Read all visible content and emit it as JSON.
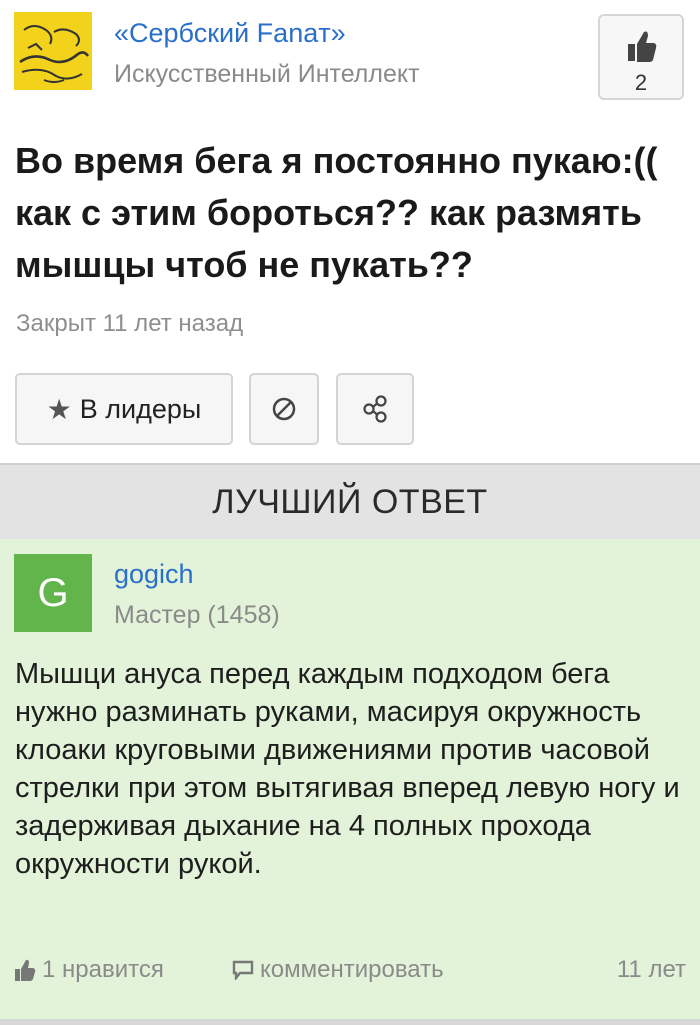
{
  "question": {
    "author": {
      "name": "«Сербский Fanaт»",
      "role": "Искусственный Интеллект",
      "avatar_icon": "yellow-drawing-avatar-icon"
    },
    "likes": {
      "count": "2",
      "icon": "thumbs-up-icon"
    },
    "title": "Во время бега я постоянно пукаю:(( как с этим бороться?? как размять мышцы чтоб не пукать??",
    "status": "Закрыт 11 лет назад",
    "actions": {
      "leaders_label": "В лидеры",
      "leaders_icon": "star-icon",
      "block_icon": "block-icon",
      "share_icon": "share-icon"
    }
  },
  "best_answer": {
    "header": "ЛУЧШИЙ ОТВЕТ",
    "author": {
      "name": "gogich",
      "rank": "Мастер (1458)",
      "avatar_letter": "G"
    },
    "text": "Мышци ануса перед каждым подходом бега нужно разминать руками, масируя окружность клоаки круговыми движениями против часовой стрелки при этом вытягивая вперед левую ногу и задерживая дыхание на 4 полных прохода окружности рукой.",
    "likes_label": "1 нравится",
    "comment_label": "комментировать",
    "age": "11 лет"
  },
  "colors": {
    "link": "#2a6fc9",
    "answer_bg": "#e3f3d9",
    "avatar_green": "#62b54b",
    "avatar_yellow": "#f2d21a",
    "best_bar": "#e3e3e3"
  }
}
